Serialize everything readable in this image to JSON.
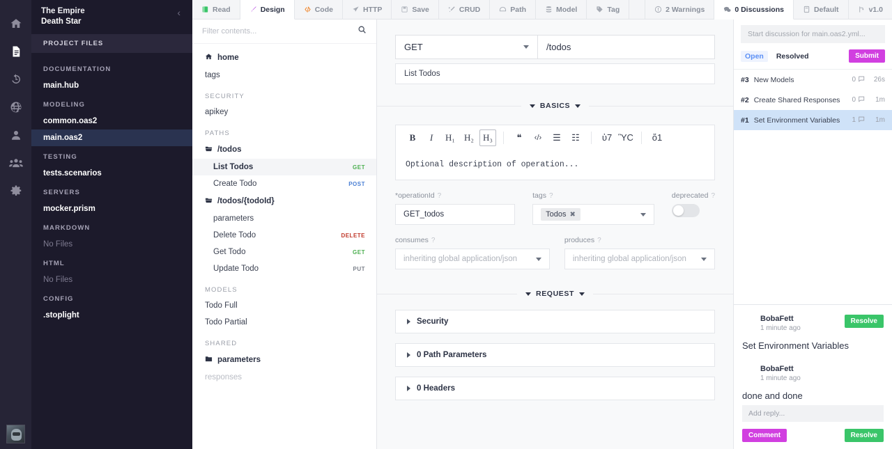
{
  "rail": {
    "items": [
      {
        "name": "home-icon",
        "label": "Home"
      },
      {
        "name": "files-icon",
        "label": "Files"
      },
      {
        "name": "history-icon",
        "label": "History"
      },
      {
        "name": "globe-icon",
        "label": "Explore"
      },
      {
        "name": "user-icon",
        "label": "Profile"
      },
      {
        "name": "team-icon",
        "label": "Team"
      },
      {
        "name": "gear-icon",
        "label": "Settings"
      }
    ]
  },
  "project": {
    "org": "The Empire",
    "name": "Death Star",
    "collapse_label": "‹",
    "files_header": "PROJECT FILES",
    "groups": [
      {
        "label": "DOCUMENTATION",
        "files": [
          {
            "label": "main.hub",
            "state": "normal"
          }
        ]
      },
      {
        "label": "MODELING",
        "files": [
          {
            "label": "common.oas2",
            "state": "normal"
          },
          {
            "label": "main.oas2",
            "state": "selected"
          }
        ]
      },
      {
        "label": "TESTING",
        "files": [
          {
            "label": "tests.scenarios",
            "state": "normal"
          }
        ]
      },
      {
        "label": "SERVERS",
        "files": [
          {
            "label": "mocker.prism",
            "state": "normal"
          }
        ]
      },
      {
        "label": "MARKDOWN",
        "files": [
          {
            "label": "No Files",
            "state": "muted"
          }
        ]
      },
      {
        "label": "HTML",
        "files": [
          {
            "label": "No Files",
            "state": "muted"
          }
        ]
      },
      {
        "label": "CONFIG",
        "files": [
          {
            "label": ".stoplight",
            "state": "normal"
          }
        ]
      }
    ]
  },
  "tabs": {
    "left": [
      {
        "label": "Read",
        "icon": "book-icon",
        "active": false
      },
      {
        "label": "Design",
        "icon": "brush-icon",
        "active": true
      },
      {
        "label": "Code",
        "icon": "code-icon",
        "active": false
      },
      {
        "label": "HTTP",
        "icon": "plane-icon",
        "active": false
      },
      {
        "label": "Save",
        "icon": "save-icon",
        "active": false
      },
      {
        "label": "CRUD",
        "icon": "wand-icon",
        "active": false
      },
      {
        "label": "Path",
        "icon": "path-icon",
        "active": false
      },
      {
        "label": "Model",
        "icon": "stack-icon",
        "active": false
      },
      {
        "label": "Tag",
        "icon": "tag-icon",
        "active": false
      }
    ],
    "right": [
      {
        "label": "2 Warnings",
        "icon": "warning-icon",
        "active": false
      },
      {
        "label": "0 Discussions",
        "icon": "comments-icon",
        "active": true
      },
      {
        "label": "Default",
        "icon": "database-icon",
        "active": false
      },
      {
        "label": "v1.0",
        "icon": "branch-icon",
        "active": false
      }
    ]
  },
  "filepanel": {
    "filter_placeholder": "Filter contents...",
    "search_icon": "search-icon",
    "rows": [
      {
        "label": "home",
        "icon": "home-icon",
        "style": "bold"
      },
      {
        "label": "tags",
        "icon": "",
        "style": "normal"
      },
      {
        "group": "SECURITY"
      },
      {
        "label": "apikey",
        "icon": "",
        "style": "normal"
      },
      {
        "group": "PATHS"
      },
      {
        "label": "/todos",
        "icon": "folder-open-icon",
        "style": "bold"
      },
      {
        "label": "List Todos",
        "icon": "",
        "style": "selected",
        "indent": true,
        "verb": "GET",
        "verb_color": "#4caf50"
      },
      {
        "label": "Create Todo",
        "icon": "",
        "style": "normal",
        "indent": true,
        "verb": "POST",
        "verb_color": "#4a7fd4"
      },
      {
        "label": "/todos/{todoId}",
        "icon": "folder-open-icon",
        "style": "bold"
      },
      {
        "label": "parameters",
        "icon": "",
        "style": "normal",
        "indent": true
      },
      {
        "label": "Delete Todo",
        "icon": "",
        "style": "normal",
        "indent": true,
        "verb": "DELETE",
        "verb_color": "#c0392b"
      },
      {
        "label": "Get Todo",
        "icon": "",
        "style": "normal",
        "indent": true,
        "verb": "GET",
        "verb_color": "#4caf50"
      },
      {
        "label": "Update Todo",
        "icon": "",
        "style": "normal",
        "indent": true,
        "verb": "PUT",
        "verb_color": "#7a7f89"
      },
      {
        "group": "MODELS"
      },
      {
        "label": "Todo Full",
        "icon": "",
        "style": "normal"
      },
      {
        "label": "Todo Partial",
        "icon": "",
        "style": "normal"
      },
      {
        "group": "SHARED"
      },
      {
        "label": "parameters",
        "icon": "folder-icon",
        "style": "bold"
      },
      {
        "label": "responses",
        "icon": "",
        "style": "muted"
      }
    ]
  },
  "editor": {
    "method": "GET",
    "path": "/todos",
    "summary": "List Todos",
    "basics_label": "BASICS",
    "request_label": "REQUEST",
    "md_buttons": [
      {
        "name": "bold-icon",
        "glyph": "B",
        "style": "bold"
      },
      {
        "name": "italic-icon",
        "glyph": "I",
        "style": "italic"
      },
      {
        "name": "heading-1-icon",
        "glyph": "H₁",
        "style": "serif"
      },
      {
        "name": "heading-2-icon",
        "glyph": "H₂",
        "style": "serif"
      },
      {
        "name": "heading-3-icon",
        "glyph": "H₃",
        "style": "serif-boxed"
      },
      {
        "name": "blockquote-icon",
        "glyph": "❝",
        "style": "plain"
      },
      {
        "name": "code-block-icon",
        "glyph": "‹/›",
        "style": "small"
      },
      {
        "name": "bullet-list-icon",
        "glyph": "☰",
        "style": "plain"
      },
      {
        "name": "numbered-list-icon",
        "glyph": "☷",
        "style": "plain"
      },
      {
        "name": "link-icon",
        "glyph": "ὑ7",
        "style": "plain"
      },
      {
        "name": "image-icon",
        "glyph": "ὛC",
        "style": "plain"
      },
      {
        "name": "preview-icon",
        "glyph": "ὄ1",
        "style": "plain"
      }
    ],
    "description_placeholder": "Optional description of operation...",
    "fields": {
      "operation_id_label": "*operationId",
      "operation_id_value": "GET_todos",
      "tags_label": "tags",
      "tags_value": "Todos",
      "deprecated_label": "deprecated",
      "consumes_label": "consumes",
      "consumes_value": "inheriting global application/json",
      "produces_label": "produces",
      "produces_value": "inheriting global application/json"
    },
    "accordions": [
      {
        "label": "Security"
      },
      {
        "label": "0 Path Parameters"
      },
      {
        "label": "0 Headers"
      }
    ]
  },
  "discussions": {
    "new_placeholder": "Start discussion for main.oas2.yml...",
    "tab_open": "Open",
    "tab_resolved": "Resolved",
    "submit_label": "Submit",
    "items": [
      {
        "num": "#3",
        "title": "New Models",
        "replies": "0",
        "time": "26s",
        "active": false
      },
      {
        "num": "#2",
        "title": "Create Shared Responses",
        "replies": "0",
        "time": "1m",
        "active": false
      },
      {
        "num": "#1",
        "title": "Set Environment Variables",
        "replies": "1",
        "time": "1m",
        "active": true
      }
    ],
    "thread": {
      "resolve_label": "Resolve",
      "messages": [
        {
          "author": "BobaFett",
          "time": "1 minute ago",
          "body": "Set Environment Variables",
          "indent": false
        },
        {
          "author": "BobaFett",
          "time": "1 minute ago",
          "body": "done and done",
          "indent": true
        }
      ]
    },
    "reply_placeholder": "Add reply...",
    "comment_label": "Comment",
    "footer_resolve_label": "Resolve"
  },
  "colors": {
    "rail_bg": "#262436",
    "sidebar_bg": "#1c1a2b",
    "selected_file": "#2a3350",
    "accent_purple": "#d13fe0",
    "accent_green": "#3ac569",
    "accent_blue": "#5a8ff5",
    "verb_get": "#4caf50",
    "verb_post": "#4a7fd4",
    "verb_delete": "#c0392b",
    "verb_put": "#7a7f89"
  }
}
